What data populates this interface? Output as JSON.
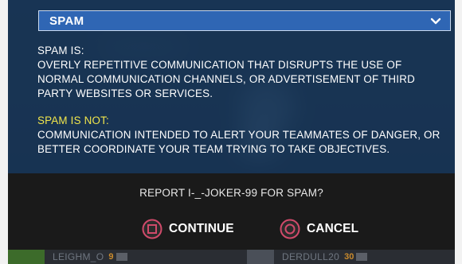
{
  "report_dialog": {
    "category_dropdown": {
      "selected": "SPAM"
    },
    "definition": {
      "is_title": "SPAM IS:",
      "is_body": "OVERLY REPETITIVE COMMUNICATION THAT DISRUPTS THE USE OF NORMAL COMMUNICATION CHANNELS, OR ADVERTISEMENT OF THIRD PARTY WEBSITES OR SERVICES.",
      "not_title": "SPAM IS NOT:",
      "not_body": "COMMUNICATION INTENDED TO ALERT YOUR TEAMMATES OF DANGER, OR BETTER COORDINATE YOUR TEAM TRYING TO TAKE OBJECTIVES."
    },
    "confirm": {
      "question": "REPORT I-_-JOKER-99 FOR SPAM?",
      "continue_label": "CONTINUE",
      "continue_icon": "square-button-icon",
      "cancel_label": "CANCEL",
      "cancel_icon": "circle-button-icon"
    }
  },
  "scoreboard_strip": {
    "left_player": {
      "name": "LEIGHM_O",
      "level": "9"
    },
    "right_player": {
      "name": "DERDULL20",
      "level": "30"
    }
  },
  "colors": {
    "dropdown_fill": "#2f66b4",
    "not_title": "#f1e64c",
    "confirm_bar": "#1a1a1a",
    "button_icon_ring": "#d04a6a"
  }
}
